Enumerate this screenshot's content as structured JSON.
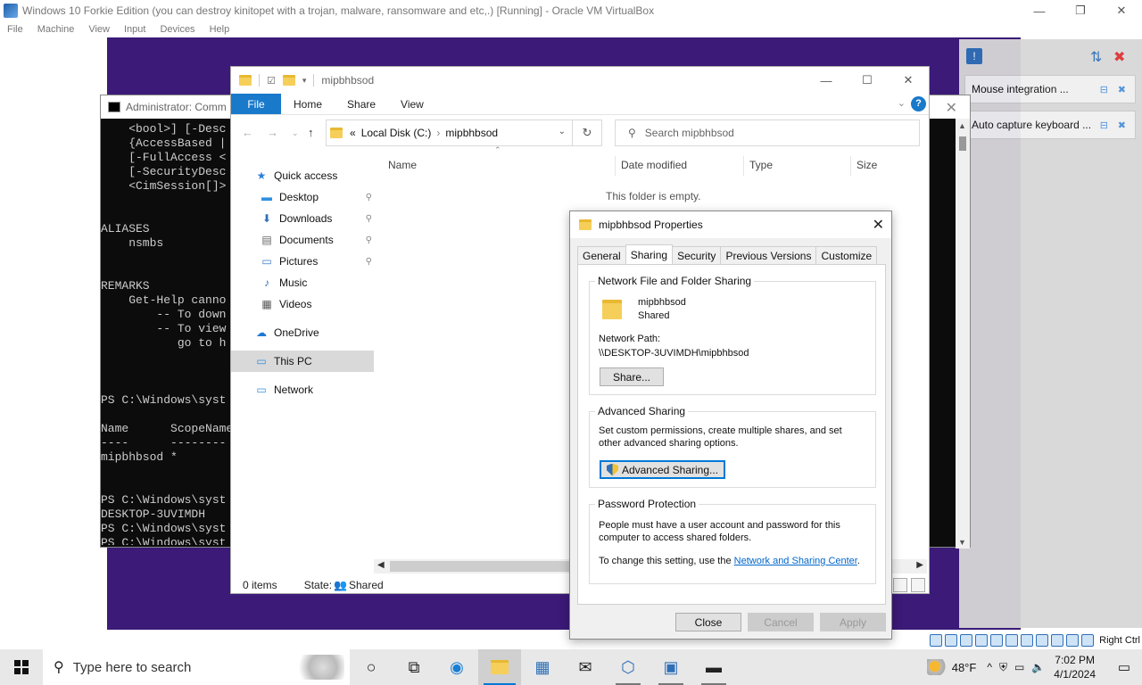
{
  "host": {
    "title": "Windows 10 Forkie Edition (you can destroy kinitopet with a trojan, malware, ransomware and etc,.) [Running] - Oracle VM VirtualBox",
    "menu": [
      "File",
      "Machine",
      "View",
      "Input",
      "Devices",
      "Help"
    ],
    "minimize": "—",
    "restore": "❐",
    "close": "✕",
    "right_ctrl": "Right Ctrl"
  },
  "vbox_notifications": [
    {
      "label": "Mouse integration ..."
    },
    {
      "label": "Auto capture keyboard ..."
    }
  ],
  "cmd": {
    "title": "Administrator: Comm",
    "close": "✕",
    "text": "    <bool>] [-Desc\n    {AccessBased |\n    [-FullAccess <\n    [-SecurityDesc\n    <CimSession[]>\n\n\nALIASES\n    nsmbs\n\n\nREMARKS\n    Get-Help canno\n        -- To down\n        -- To view\n           go to h\n\n\n\nPS C:\\Windows\\syst\n\nName      ScopeName\n----      --------\nmipbhbsod *\n\n\nPS C:\\Windows\\syst\nDESKTOP-3UVIMDH\nPS C:\\Windows\\syst\nPS C:\\Windows\\syst"
  },
  "explorer": {
    "title": "mipbhbsod",
    "minimize": "—",
    "maximize": "☐",
    "close": "✕",
    "ribbon": {
      "file": "File",
      "tabs": [
        "Home",
        "Share",
        "View"
      ],
      "help": "?"
    },
    "address": {
      "prefix": "«",
      "crumbs": [
        "Local Disk (C:)",
        "›",
        "mipbhbsod"
      ]
    },
    "search_placeholder": "Search mipbhbsod",
    "nav": [
      {
        "label": "Quick access",
        "icon": "star-icon",
        "glyph": "★",
        "color": "#2f7fd8",
        "pinned": false,
        "sub": false
      },
      {
        "label": "Desktop",
        "icon": "desktop-icon",
        "glyph": "▬",
        "color": "#2f8fe0",
        "pinned": true,
        "sub": true
      },
      {
        "label": "Downloads",
        "icon": "download-icon",
        "glyph": "⬇",
        "color": "#2f6fb7",
        "pinned": true,
        "sub": true
      },
      {
        "label": "Documents",
        "icon": "document-icon",
        "glyph": "▤",
        "color": "#666",
        "pinned": true,
        "sub": true
      },
      {
        "label": "Pictures",
        "icon": "pictures-icon",
        "glyph": "▭",
        "color": "#3a7cc4",
        "pinned": true,
        "sub": true
      },
      {
        "label": "Music",
        "icon": "music-icon",
        "glyph": "♪",
        "color": "#2f6fb7",
        "pinned": false,
        "sub": true
      },
      {
        "label": "Videos",
        "icon": "videos-icon",
        "glyph": "▦",
        "color": "#555",
        "pinned": false,
        "sub": true
      },
      {
        "label": "OneDrive",
        "icon": "cloud-icon",
        "glyph": "☁",
        "color": "#1e78d6",
        "pinned": false,
        "sub": false
      },
      {
        "label": "This PC",
        "icon": "computer-icon",
        "glyph": "▭",
        "color": "#2f8fe0",
        "pinned": false,
        "sub": false
      },
      {
        "label": "Network",
        "icon": "network-icon",
        "glyph": "▭",
        "color": "#2f8fe0",
        "pinned": false,
        "sub": false
      }
    ],
    "pin_glyph": "📌",
    "columns": [
      "Name",
      "Date modified",
      "Type",
      "Size"
    ],
    "empty_message": "This folder is empty.",
    "status": {
      "items": "0 items",
      "state_label": "State:",
      "state_value": "Shared"
    }
  },
  "properties": {
    "title": "mipbhbsod Properties",
    "close": "✕",
    "tabs": [
      "General",
      "Sharing",
      "Security",
      "Previous Versions",
      "Customize"
    ],
    "active_tab": "Sharing",
    "network_sharing": {
      "legend": "Network File and Folder Sharing",
      "folder_name": "mipbhbsod",
      "folder_state": "Shared",
      "path_label": "Network Path:",
      "path_value": "\\\\DESKTOP-3UVIMDH\\mipbhbsod",
      "share_button": "Share..."
    },
    "advanced_sharing": {
      "legend": "Advanced Sharing",
      "description": "Set custom permissions, create multiple shares, and set other advanced sharing options.",
      "button": "Advanced Sharing..."
    },
    "password_protection": {
      "legend": "Password Protection",
      "description": "People must have a user account and password for this computer to access shared folders.",
      "change_prefix": "To change this setting, use the",
      "link": "Network and Sharing Center",
      "suffix": "."
    },
    "buttons": {
      "close": "Close",
      "cancel": "Cancel",
      "apply": "Apply"
    }
  },
  "taskbar": {
    "search_placeholder": "Type here to search",
    "weather": "48°F",
    "time": "7:02 PM",
    "date": "4/1/2024"
  }
}
